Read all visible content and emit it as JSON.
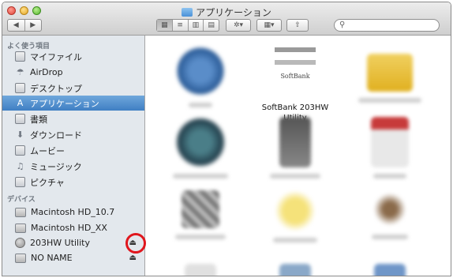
{
  "window": {
    "title": "アプリケーション",
    "toolbar": {
      "back_glyph": "◀",
      "forward_glyph": "▶",
      "view_modes": [
        "▦",
        "≡",
        "▥",
        "▤"
      ],
      "action_glyph": "✲▾",
      "arrange_glyph": "▦▾",
      "share_glyph": "⇧"
    }
  },
  "sidebar": {
    "favorites_heading": "よく使う項目",
    "favorites": [
      {
        "label": "マイファイル",
        "icon": "file-icon"
      },
      {
        "label": "AirDrop",
        "icon": "airdrop-icon"
      },
      {
        "label": "デスクトップ",
        "icon": "desktop-icon"
      },
      {
        "label": "アプリケーション",
        "icon": "applications-icon"
      },
      {
        "label": "書類",
        "icon": "documents-icon"
      },
      {
        "label": "ダウンロード",
        "icon": "downloads-icon"
      },
      {
        "label": "ムービー",
        "icon": "movies-icon"
      },
      {
        "label": "ミュージック",
        "icon": "music-icon"
      },
      {
        "label": "ピクチャ",
        "icon": "pictures-icon"
      }
    ],
    "devices_heading": "デバイス",
    "devices": [
      {
        "label": "Macintosh HD_10.7",
        "icon": "hard-disk-icon"
      },
      {
        "label": "Macintosh HD_XX",
        "icon": "hard-disk-icon"
      },
      {
        "label": "203HW Utility",
        "icon": "cd-icon"
      },
      {
        "label": "NO NAME",
        "icon": "drive-icon"
      }
    ],
    "eject_glyph": "⏏"
  },
  "content": {
    "softbank_brand": "SoftBank",
    "softbank_label": "SoftBank 203HW Utility"
  },
  "colors": {
    "selection": "#3f7fc3",
    "highlight_ring": "#e0161d"
  }
}
